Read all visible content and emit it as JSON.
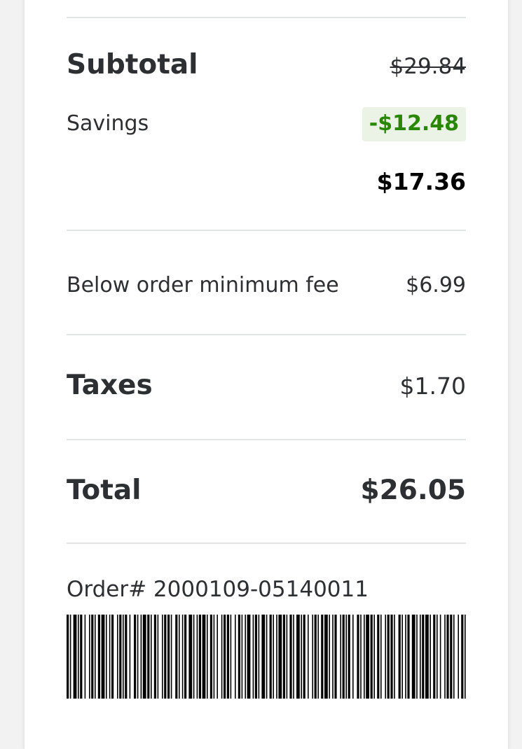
{
  "summary": {
    "subtotal_label": "Subtotal",
    "subtotal_original": "$29.84",
    "savings_label": "Savings",
    "savings_value": "-$12.48",
    "subtotal_final": "$17.36",
    "fee_label": "Below order minimum fee",
    "fee_value": "$6.99",
    "taxes_label": "Taxes",
    "taxes_value": "$1.70",
    "total_label": "Total",
    "total_value": "$26.05"
  },
  "order": {
    "number_text": "Order# 2000109-05140011"
  },
  "colors": {
    "savings_green": "#2a8703",
    "savings_bg": "#eaf3e6",
    "text": "#2e2f32",
    "divider": "#e3e4e5"
  }
}
